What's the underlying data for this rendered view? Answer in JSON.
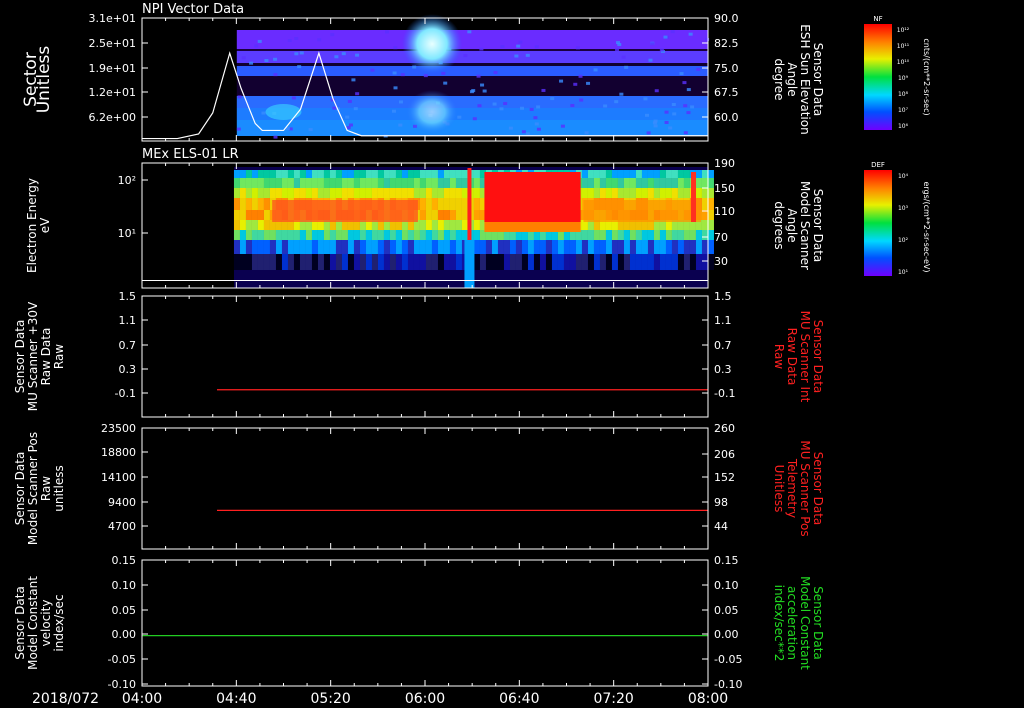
{
  "chart_data": [
    {
      "type": "heatmap",
      "title": "NPI Vector Data",
      "ylabel_left": [
        "Sector",
        "Unitless"
      ],
      "yticks_left": [
        "3.1e+01",
        "2.5e+01",
        "1.9e+01",
        "1.2e+01",
        "6.2e+00"
      ],
      "ylabel_right": [
        "Sensor Data",
        "ESH Sun Elevation",
        "Angle",
        "degree"
      ],
      "yticks_right": [
        "90.0",
        "82.5",
        "75.0",
        "67.5",
        "60.0"
      ],
      "yrange_right": [
        55,
        90
      ],
      "colorbar": {
        "label": "NF",
        "units": "cnts/(cm**2-sr-sec)",
        "ticks": [
          "10¹²",
          "10¹¹",
          "10¹⁰",
          "10⁹",
          "10⁸",
          "10⁷",
          "10⁶"
        ]
      },
      "series": [
        {
          "values": [
            [
              4.0,
              55.7
            ],
            [
              4.25,
              55.7
            ],
            [
              4.4,
              57
            ],
            [
              4.5,
              63
            ],
            [
              4.62,
              80
            ],
            [
              4.7,
              70
            ],
            [
              4.8,
              60
            ],
            [
              4.85,
              58
            ],
            [
              5.0,
              58
            ],
            [
              5.12,
              64
            ],
            [
              5.25,
              80
            ],
            [
              5.35,
              67
            ],
            [
              5.45,
              58
            ],
            [
              5.55,
              56.5
            ],
            [
              8.0,
              56.5
            ]
          ]
        }
      ],
      "data_begins_hours": 4.67
    },
    {
      "type": "heatmap",
      "title": "MEx ELS-01 LR",
      "ylabel_left": [
        "Electron Energy",
        "eV"
      ],
      "yticks_left": [
        "10²",
        "10¹"
      ],
      "ylabel_right": [
        "Sensor Data",
        "Model Scanner",
        "Angle",
        "degrees"
      ],
      "yticks_right": [
        "190",
        "150",
        "110",
        "70",
        "30"
      ],
      "yrange_right": [
        -10,
        190
      ],
      "colorbar": {
        "label": "DEF",
        "units": "ergs/(cm**2-sr-sec-eV)",
        "ticks": [
          "10⁴",
          "10³",
          "10²",
          "10¹"
        ]
      },
      "series": [
        {
          "values": [
            [
              4.0,
              2
            ],
            [
              8.0,
              2
            ]
          ]
        }
      ],
      "data_begins_hours": 4.65
    },
    {
      "type": "line",
      "ylabel_left": [
        "Sensor Data",
        "MU Scanner +30V",
        "Raw Data",
        "Raw"
      ],
      "yticks_left": [
        "1.5",
        "1.1",
        "0.7",
        "0.3",
        "-0.1"
      ],
      "ylim": [
        -0.5,
        1.5
      ],
      "ylabel_right": [
        "Sensor Data",
        "MU Scanner Int",
        "Raw Data",
        "Raw"
      ],
      "yticks_right": [
        "1.5",
        "1.1",
        "0.7",
        "0.3",
        "-0.1"
      ],
      "series": [
        {
          "color": "#ff2020",
          "values": [
            [
              4.53,
              -0.05
            ],
            [
              8.0,
              -0.05
            ]
          ]
        }
      ]
    },
    {
      "type": "line",
      "ylabel_left": [
        "Sensor Data",
        "Model Scanner Pos",
        "Raw",
        "unitless"
      ],
      "yticks_left": [
        "23500",
        "18800",
        "14100",
        "9400",
        "4700"
      ],
      "ylim": [
        0,
        23500
      ],
      "ylabel_right": [
        "Sensor Data",
        "MU Scanner Pos",
        "Telemetry",
        "Unitless"
      ],
      "yticks_right": [
        "260",
        "206",
        "152",
        "98",
        "44"
      ],
      "series": [
        {
          "color": "#ff2020",
          "values": [
            [
              4.53,
              7500
            ],
            [
              8.0,
              7500
            ]
          ]
        }
      ]
    },
    {
      "type": "line",
      "ylabel_left": [
        "Sensor Data",
        "Model Constant",
        "velocity",
        "index/sec"
      ],
      "yticks_left": [
        "0.15",
        "0.10",
        "0.05",
        "0.00",
        "-0.05",
        "-0.10"
      ],
      "ylim": [
        -0.1,
        0.15
      ],
      "ylabel_right": [
        "Sensor Data",
        "Model Constant",
        "acceleration",
        "index/sec**2"
      ],
      "yticks_right": [
        "0.15",
        "0.10",
        "0.05",
        "0.00",
        "-0.05",
        "-0.10"
      ],
      "series": [
        {
          "color": "#22cc22",
          "values": [
            [
              4.0,
              0.0
            ],
            [
              8.0,
              0.0
            ]
          ]
        }
      ]
    }
  ],
  "xaxis": {
    "date": "2018/072",
    "ticks": [
      "04:00",
      "04:40",
      "05:20",
      "06:00",
      "06:40",
      "07:20",
      "08:00"
    ],
    "range_hours": [
      4.0,
      8.0
    ]
  }
}
